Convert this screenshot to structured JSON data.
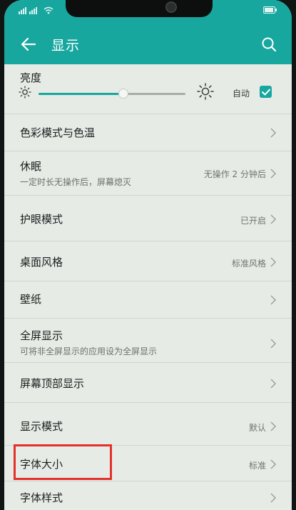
{
  "appbar": {
    "title": "显示"
  },
  "brightness": {
    "label": "亮度",
    "auto_label": "自动",
    "auto_checked": true,
    "level": 0.58
  },
  "items": [
    {
      "title": "色彩模式与色温",
      "subtitle": "",
      "value": ""
    },
    {
      "title": "休眠",
      "subtitle": "一定时长无操作后，屏幕熄灭",
      "value": "无操作 2 分钟后"
    },
    {
      "title": "护眼模式",
      "subtitle": "",
      "value": "已开启"
    },
    {
      "title": "桌面风格",
      "subtitle": "",
      "value": "标准风格"
    },
    {
      "title": "壁纸",
      "subtitle": "",
      "value": ""
    },
    {
      "title": "全屏显示",
      "subtitle": "可将非全屏显示的应用设为全屏显示",
      "value": ""
    },
    {
      "title": "屏幕顶部显示",
      "subtitle": "",
      "value": ""
    },
    {
      "title": "显示模式",
      "subtitle": "",
      "value": "默认"
    },
    {
      "title": "字体大小",
      "subtitle": "",
      "value": "标准"
    },
    {
      "title": "字体样式",
      "subtitle": "",
      "value": ""
    }
  ],
  "colors": {
    "accent": "#18a79f",
    "highlight": "#e4312b",
    "background": "#e6ebe6"
  },
  "icons": {
    "back": "arrow-left-icon",
    "search": "search-icon",
    "sun": "sun-icon",
    "chevron": "chevron-right-icon"
  }
}
